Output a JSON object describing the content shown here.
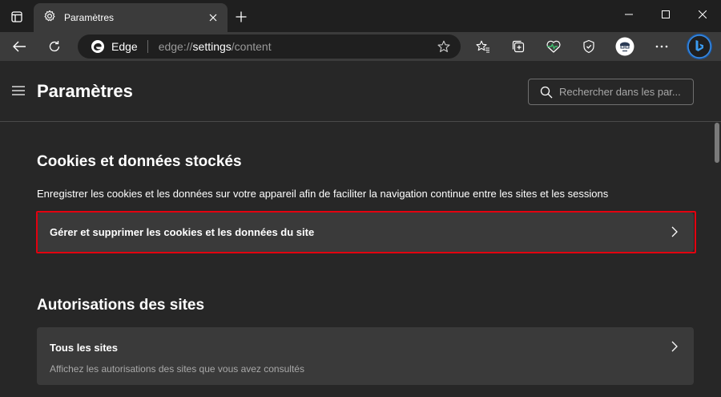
{
  "titlebar": {
    "tab_title": "Paramètres",
    "icons": {
      "tab_actions": "tab-actions-icon",
      "tab_favicon": "gear-icon",
      "tab_close": "close-icon",
      "new_tab": "plus-icon",
      "minimize": "minimize-icon",
      "maximize": "maximize-icon",
      "close_window": "close-icon"
    }
  },
  "toolbar": {
    "site_label": "Edge",
    "url_scheme": "edge://",
    "url_host": "settings",
    "url_path": "/content",
    "icons": [
      "back-icon",
      "refresh-icon",
      "favorite-star-icon",
      "favorites-icon",
      "collections-icon",
      "browser-essentials-icon",
      "security-icon",
      "profile-avatar",
      "more-icon",
      "bing-copilot-icon"
    ]
  },
  "header": {
    "title": "Paramètres",
    "search_placeholder": "Rechercher dans les par..."
  },
  "cookies_section": {
    "heading": "Cookies et données stockés",
    "description": "Enregistrer les cookies et les données sur votre appareil afin de faciliter la navigation continue entre les sites et les sessions",
    "manage_item_label": "Gérer et supprimer les cookies et les données du site"
  },
  "permissions_section": {
    "heading": "Autorisations des sites",
    "all_sites_label": "Tous les sites",
    "all_sites_sub": "Affichez les autorisations des sites que vous avez consultés"
  },
  "colors": {
    "accent_highlight": "#e3000f",
    "background": "#272727",
    "card": "#3a3a3a",
    "toolbar": "#3b3b3b",
    "titlebar": "#1f1f1f"
  }
}
